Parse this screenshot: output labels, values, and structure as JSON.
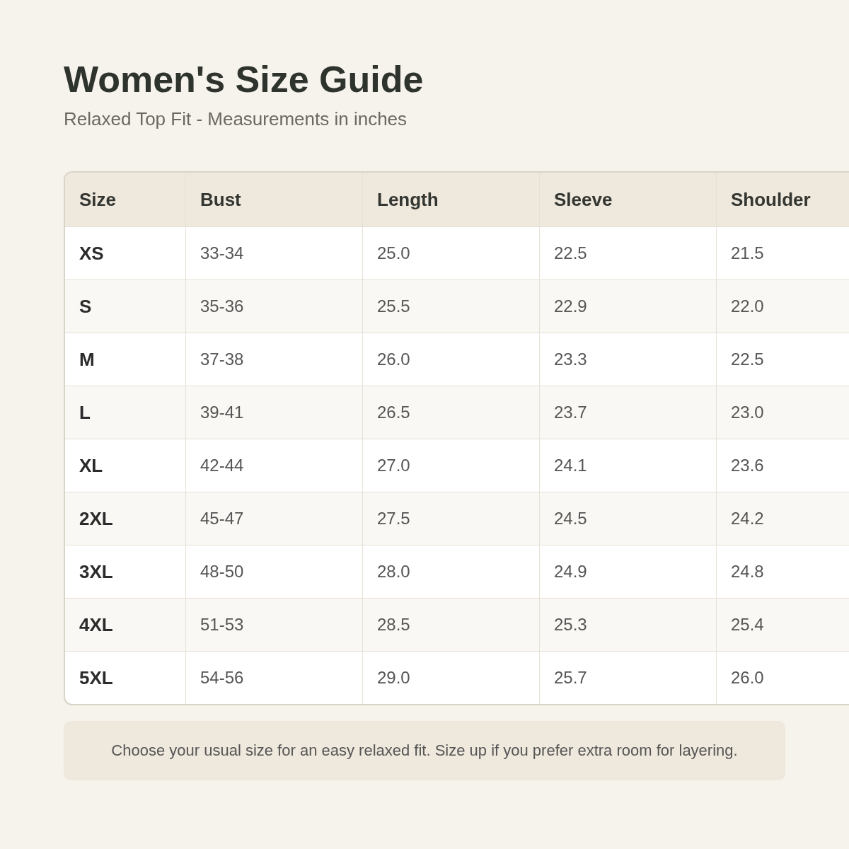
{
  "title": "Women's Size Guide",
  "subtitle": "Relaxed Top Fit - Measurements in inches",
  "table": {
    "columns": [
      "Size",
      "Bust",
      "Length",
      "Sleeve",
      "Shoulder"
    ],
    "rows": [
      [
        "XS",
        "33-34",
        "25.0",
        "22.5",
        "21.5"
      ],
      [
        "S",
        "35-36",
        "25.5",
        "22.9",
        "22.0"
      ],
      [
        "M",
        "37-38",
        "26.0",
        "23.3",
        "22.5"
      ],
      [
        "L",
        "39-41",
        "26.5",
        "23.7",
        "23.0"
      ],
      [
        "XL",
        "42-44",
        "27.0",
        "24.1",
        "23.6"
      ],
      [
        "2XL",
        "45-47",
        "27.5",
        "24.5",
        "24.2"
      ],
      [
        "3XL",
        "48-50",
        "28.0",
        "24.9",
        "24.8"
      ],
      [
        "4XL",
        "51-53",
        "28.5",
        "25.3",
        "25.4"
      ],
      [
        "5XL",
        "54-56",
        "29.0",
        "25.7",
        "26.0"
      ]
    ]
  },
  "note": "Choose your usual size for an easy relaxed fit. Size up if you prefer extra room for layering."
}
